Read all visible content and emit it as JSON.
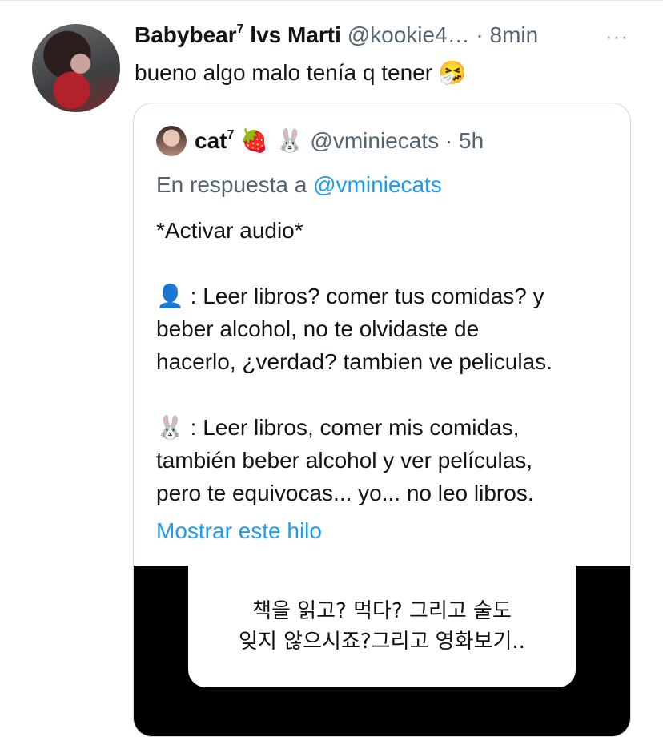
{
  "tweet": {
    "name": "Babybear",
    "name_sup": "7",
    "name_suffix": " lvs Marti",
    "handle": "@kookie4…",
    "dot": " · ",
    "time": "8min",
    "more": "···",
    "text": "bueno algo malo tenía q tener",
    "text_emoji": "🤧"
  },
  "quote": {
    "name": "cat",
    "name_sup": "7",
    "name_emojis": "🍓 🐰",
    "handle": "@vminiecats",
    "time": "· 5h",
    "reply_prefix": "En respuesta a",
    "reply_handle": "@vminiecats",
    "lines": {
      "l1": "*Activar audio*",
      "l2_emoji": "👤",
      "l2": " : Leer libros? comer tus comidas? y",
      "l3": "beber alcohol, no te olvidaste de",
      "l4": "hacerlo, ¿verdad? tambien ve peliculas.",
      "l5_emoji": "🐰",
      "l5": ": Leer libros, comer mis comidas,",
      "l6": "también beber alcohol y ver películas,",
      "l7": "pero te equivocas... yo... no leo libros."
    },
    "show_thread": "Mostrar este hilo",
    "media_text_1": "책을 읽고? 먹다? 그리고 술도",
    "media_text_2": "잊지 않으시죠?그리고 영화보기.."
  }
}
